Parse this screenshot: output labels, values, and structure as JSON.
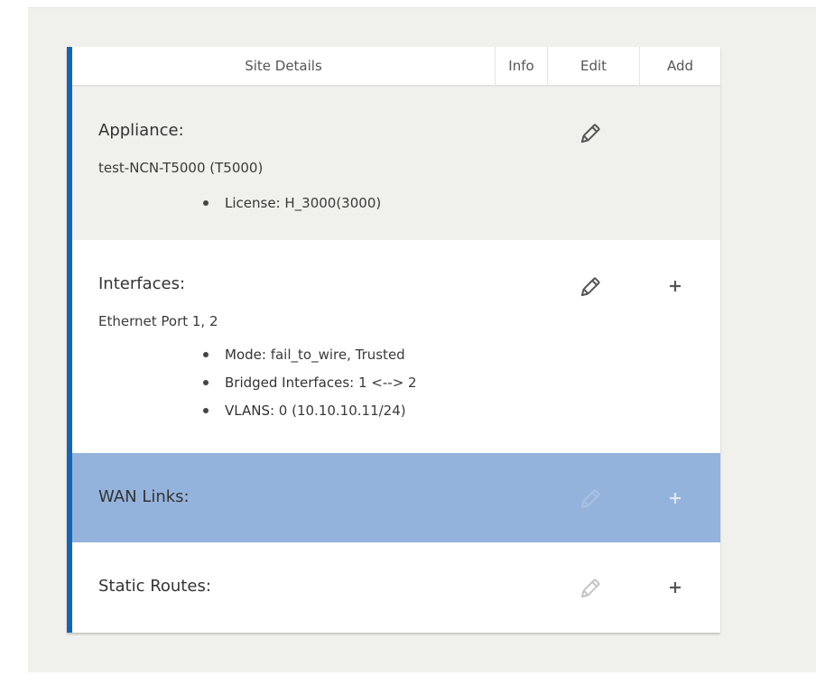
{
  "header": {
    "site_details": "Site Details",
    "info": "Info",
    "edit": "Edit",
    "add": "Add"
  },
  "appliance": {
    "title": "Appliance:",
    "subtitle": "test-NCN-T5000 (T5000)",
    "bullets": [
      {
        "key": "License:",
        "value": " H_3000(3000)"
      }
    ],
    "edit_icon": "pencil-icon",
    "edit_enabled": true
  },
  "interfaces": {
    "title": "Interfaces:",
    "subtitle": "Ethernet Port 1, 2",
    "bullets": [
      {
        "key": "Mode:",
        "value": " fail_to_wire, Trusted"
      },
      {
        "key": "Bridged Interfaces:",
        "value": " 1 <--> 2"
      },
      {
        "key": "VLANS:",
        "value": " 0 (10.10.10.11/24)"
      }
    ],
    "edit_icon": "pencil-icon",
    "add_icon": "plus-icon",
    "edit_enabled": true
  },
  "wan_links": {
    "title": "WAN Links:",
    "edit_icon": "pencil-icon",
    "add_icon": "plus-icon",
    "edit_enabled": false,
    "highlight_color": "#94b3dc"
  },
  "static_routes": {
    "title": "Static Routes:",
    "edit_icon": "pencil-icon",
    "add_icon": "plus-icon",
    "edit_enabled": false
  },
  "colors": {
    "accent_bar": "#1565b5",
    "selected_row": "#94b3dc",
    "panel_bg": "#f0f0ec",
    "icon_active": "#555555",
    "icon_disabled": "#c4c4c4"
  }
}
